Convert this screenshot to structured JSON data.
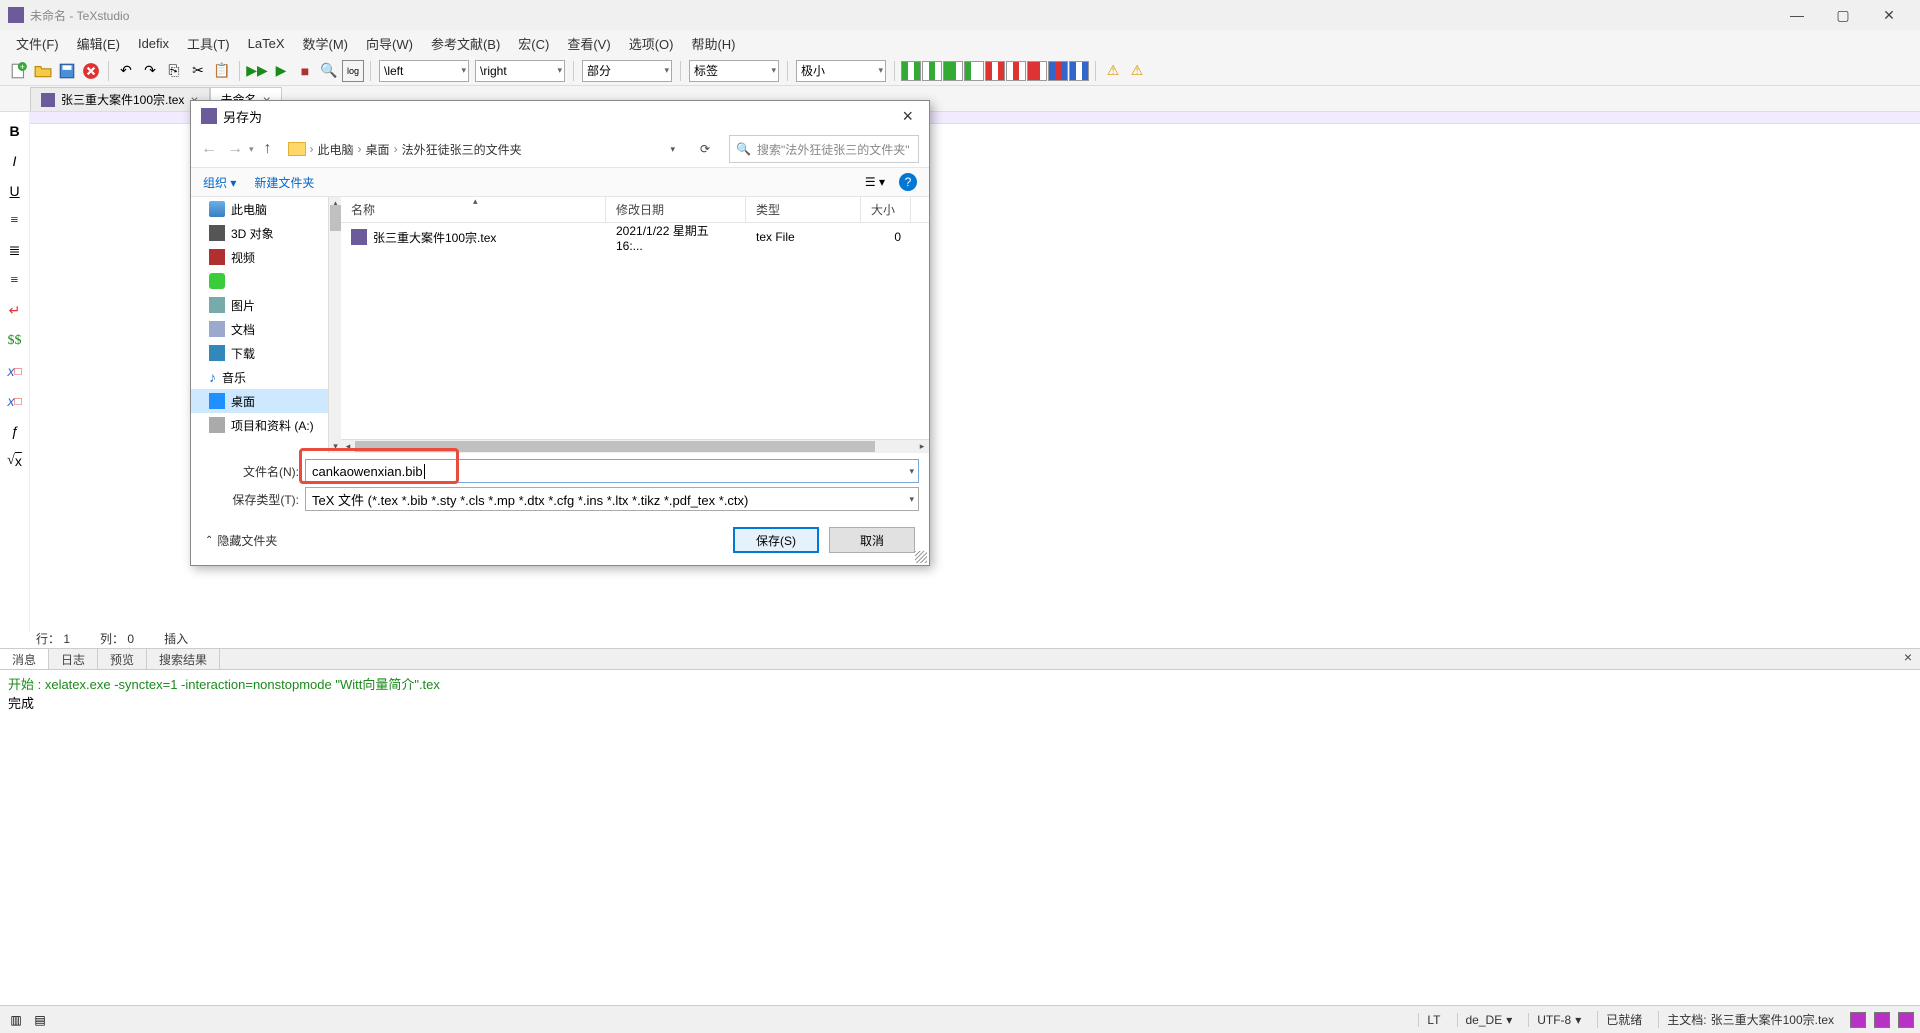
{
  "title": "未命名 - TeXstudio",
  "menu": [
    "文件(F)",
    "编辑(E)",
    "Idefix",
    "工具(T)",
    "LaTeX",
    "数学(M)",
    "向导(W)",
    "参考文献(B)",
    "宏(C)",
    "查看(V)",
    "选项(O)",
    "帮助(H)"
  ],
  "toolbar": {
    "left_combo": "\\left",
    "right_combo": "\\right",
    "part_combo": "部分",
    "label_combo": "标签",
    "tiny_combo": "极小"
  },
  "tabs": [
    {
      "label": "张三重大案件100宗.tex",
      "active": false
    },
    {
      "label": "未命名",
      "active": true
    }
  ],
  "edit_status": {
    "line_label": "行：",
    "line": "1",
    "col_label": "列：",
    "col": "0",
    "mode": "插入"
  },
  "bottom_tabs": [
    "消息",
    "日志",
    "预览",
    "搜索结果"
  ],
  "log": {
    "start": "开始 : xelatex.exe -synctex=1 -interaction=nonstopmode \"Witt向量简介\".tex",
    "done": "完成"
  },
  "statusbar": {
    "lt": "LT",
    "locale": "de_DE",
    "encoding": "UTF-8",
    "ready": "已就绪",
    "master_label": "主文档:",
    "master_file": "张三重大案件100宗.tex"
  },
  "dialog": {
    "title": "另存为",
    "breadcrumb": [
      "此电脑",
      "桌面",
      "法外狂徒张三的文件夹"
    ],
    "search_placeholder": "搜索\"法外狂徒张三的文件夹\"",
    "toolbar": {
      "organize": "组织",
      "new_folder": "新建文件夹"
    },
    "tree": [
      {
        "label": "此电脑",
        "icon": "ico-pc"
      },
      {
        "label": "3D 对象",
        "icon": "ico-3d"
      },
      {
        "label": "视频",
        "icon": "ico-video"
      },
      {
        "label": "",
        "icon": "ico-cloud"
      },
      {
        "label": "图片",
        "icon": "ico-pic"
      },
      {
        "label": "文档",
        "icon": "ico-doc"
      },
      {
        "label": "下载",
        "icon": "ico-dl"
      },
      {
        "label": "音乐",
        "icon": "ico-music"
      },
      {
        "label": "桌面",
        "icon": "ico-desktop",
        "selected": true
      },
      {
        "label": "项目和资料 (A:)",
        "icon": "ico-drive"
      }
    ],
    "columns": {
      "name": "名称",
      "date": "修改日期",
      "type": "类型",
      "size": "大小"
    },
    "files": [
      {
        "name": "张三重大案件100宗.tex",
        "date": "2021/1/22 星期五 16:...",
        "type": "tex File",
        "size": "0"
      }
    ],
    "filename_label": "文件名(N):",
    "filename_value": "cankaowenxian.bib",
    "filetype_label": "保存类型(T):",
    "filetype_value": "TeX 文件 (*.tex *.bib *.sty *.cls *.mp *.dtx *.cfg *.ins *.ltx *.tikz *.pdf_tex *.ctx)",
    "hide_folders": "隐藏文件夹",
    "save_btn": "保存(S)",
    "cancel_btn": "取消"
  }
}
